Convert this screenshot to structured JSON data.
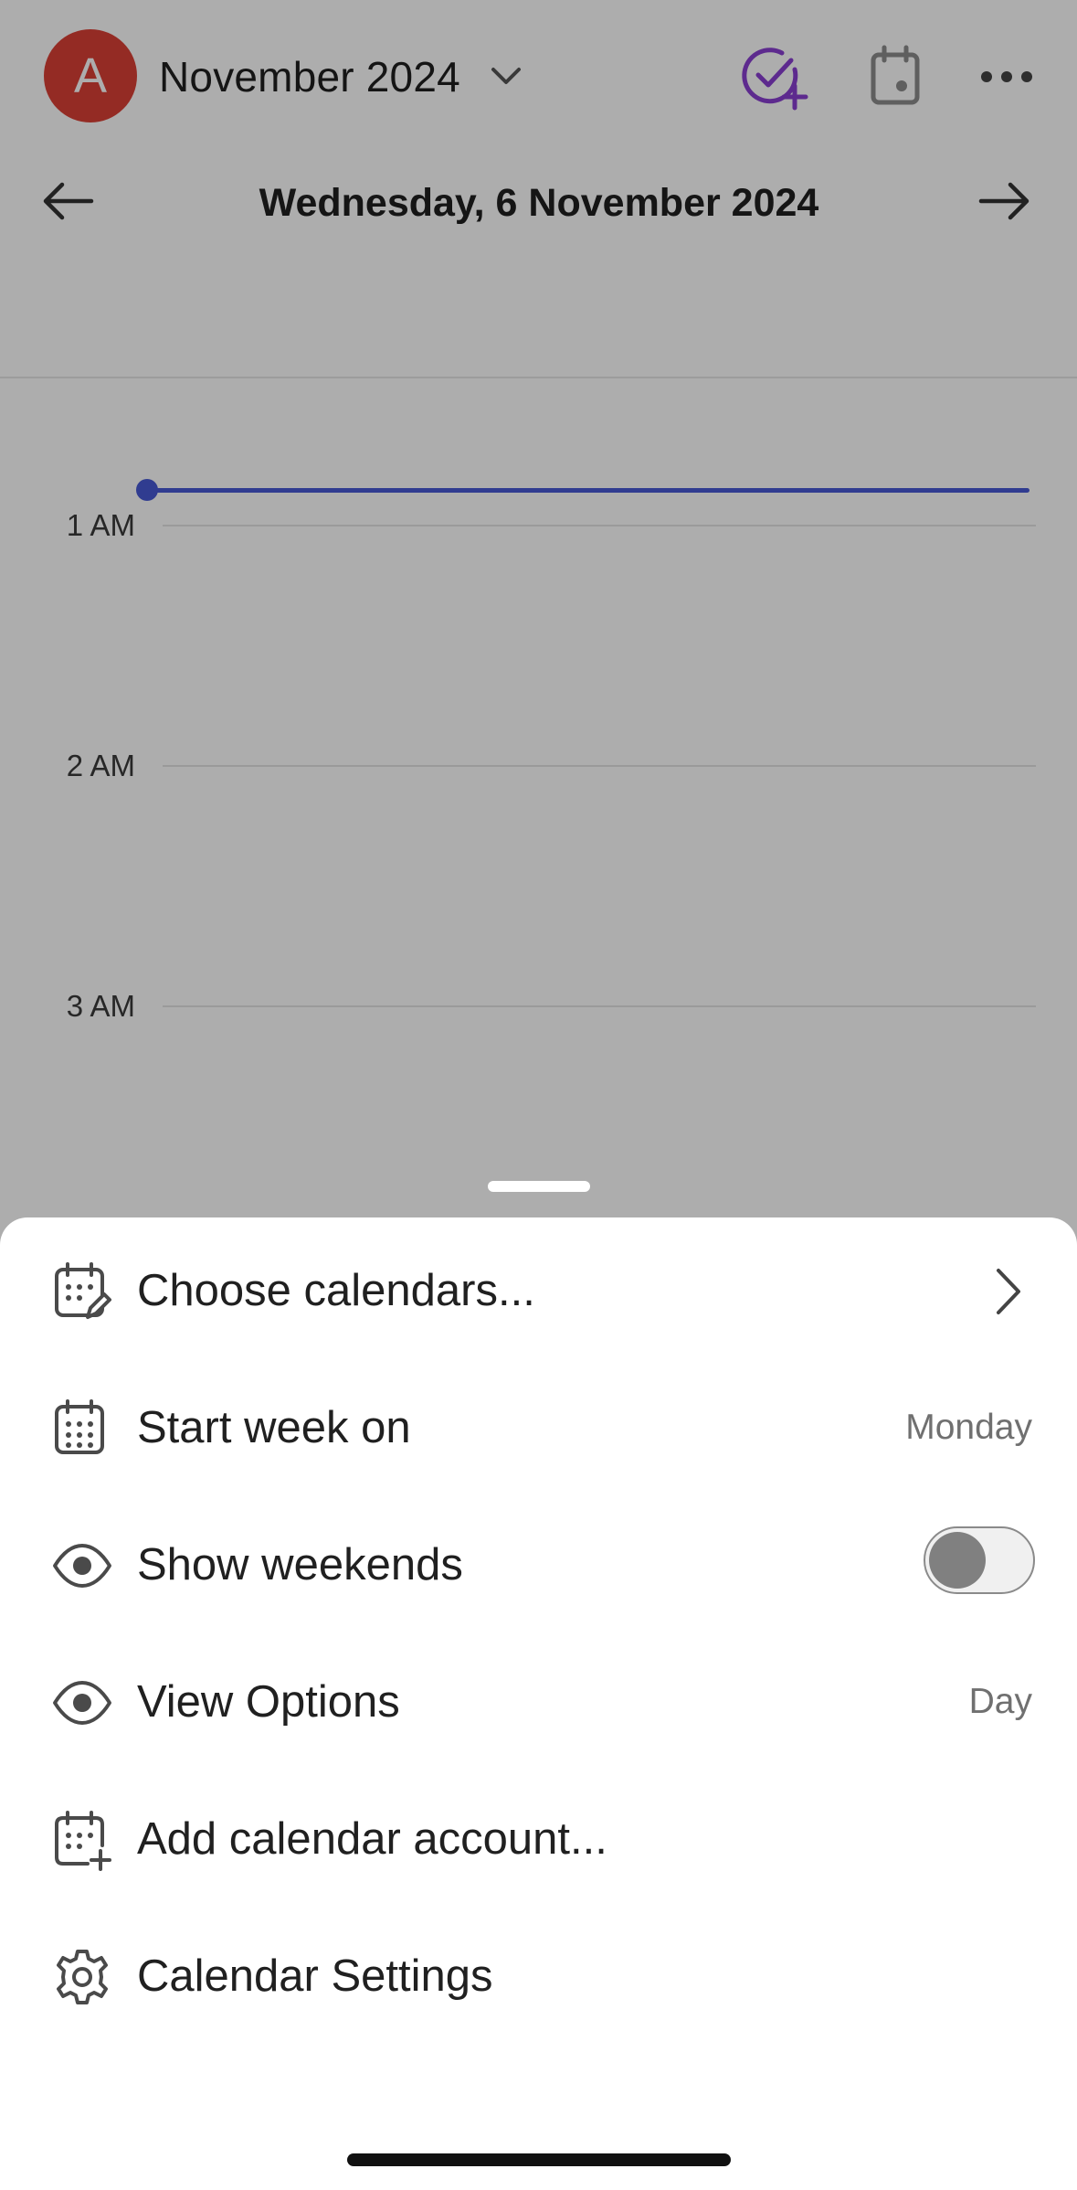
{
  "header": {
    "avatar_letter": "A",
    "month_title": "November 2024",
    "day_title": "Wednesday, 6 November 2024",
    "icons": [
      "chevron-down-icon",
      "add-task-icon",
      "calendar-today-icon",
      "more-icon",
      "arrow-left-icon",
      "arrow-right-icon"
    ]
  },
  "timeline": {
    "hours": [
      "1 AM",
      "2 AM",
      "3 AM"
    ]
  },
  "sheet": {
    "items": [
      {
        "label": "Choose calendars...",
        "icon": "calendar-edit-icon",
        "accessory": "chevron"
      },
      {
        "label": "Start week on",
        "icon": "calendar-icon",
        "value": "Monday"
      },
      {
        "label": "Show weekends",
        "icon": "eye-icon",
        "toggle_on": false
      },
      {
        "label": "View Options",
        "icon": "eye-icon",
        "value": "Day"
      },
      {
        "label": "Add calendar account...",
        "icon": "calendar-add-icon"
      },
      {
        "label": "Calendar Settings",
        "icon": "gear-icon"
      }
    ]
  },
  "colors": {
    "avatar": "#db4035",
    "accent_purple": "#8a3fd1",
    "now_line": "#4759d4",
    "icon_gray": "#8c8c8c"
  }
}
